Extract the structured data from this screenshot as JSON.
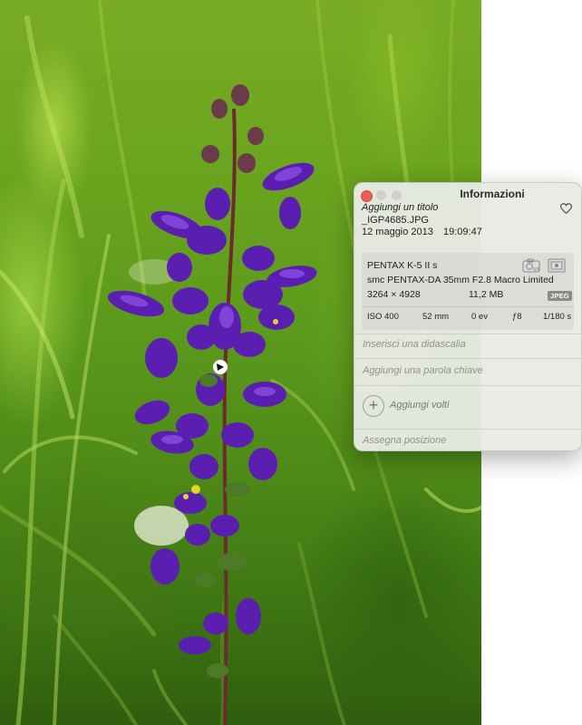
{
  "info_panel": {
    "title": "Informazioni",
    "photo_title_placeholder": "Aggiungi un titolo",
    "filename": "_IGP4685.JPG",
    "date": "12 maggio 2013",
    "time": "19:09:47",
    "favorite_icon": "heart-outline-icon",
    "camera": {
      "model": "PENTAX K-5 II s",
      "lens": "smc PENTAX-DA 35mm F2.8 Macro Limited",
      "dimensions": "3264 × 4928",
      "file_size": "11,2 MB",
      "format": "JPEG",
      "icons": [
        "camera-wb-icon",
        "metering-icon"
      ]
    },
    "exposure": {
      "iso": "ISO 400",
      "focal_length": "52 mm",
      "exposure_bias": "0 ev",
      "aperture": "ƒ8",
      "shutter": "1/180 s"
    },
    "caption_placeholder": "Inserisci una didascalia",
    "keyword_placeholder": "Aggiungi una parola chiave",
    "faces_label": "Aggiungi volti",
    "location_placeholder": "Assegna posizione"
  },
  "colors": {
    "close_button": "#ec5f57",
    "inactive_button": "#cfcfcf",
    "panel_background": "#e8eae4",
    "placeholder_text": "#8f918c"
  }
}
